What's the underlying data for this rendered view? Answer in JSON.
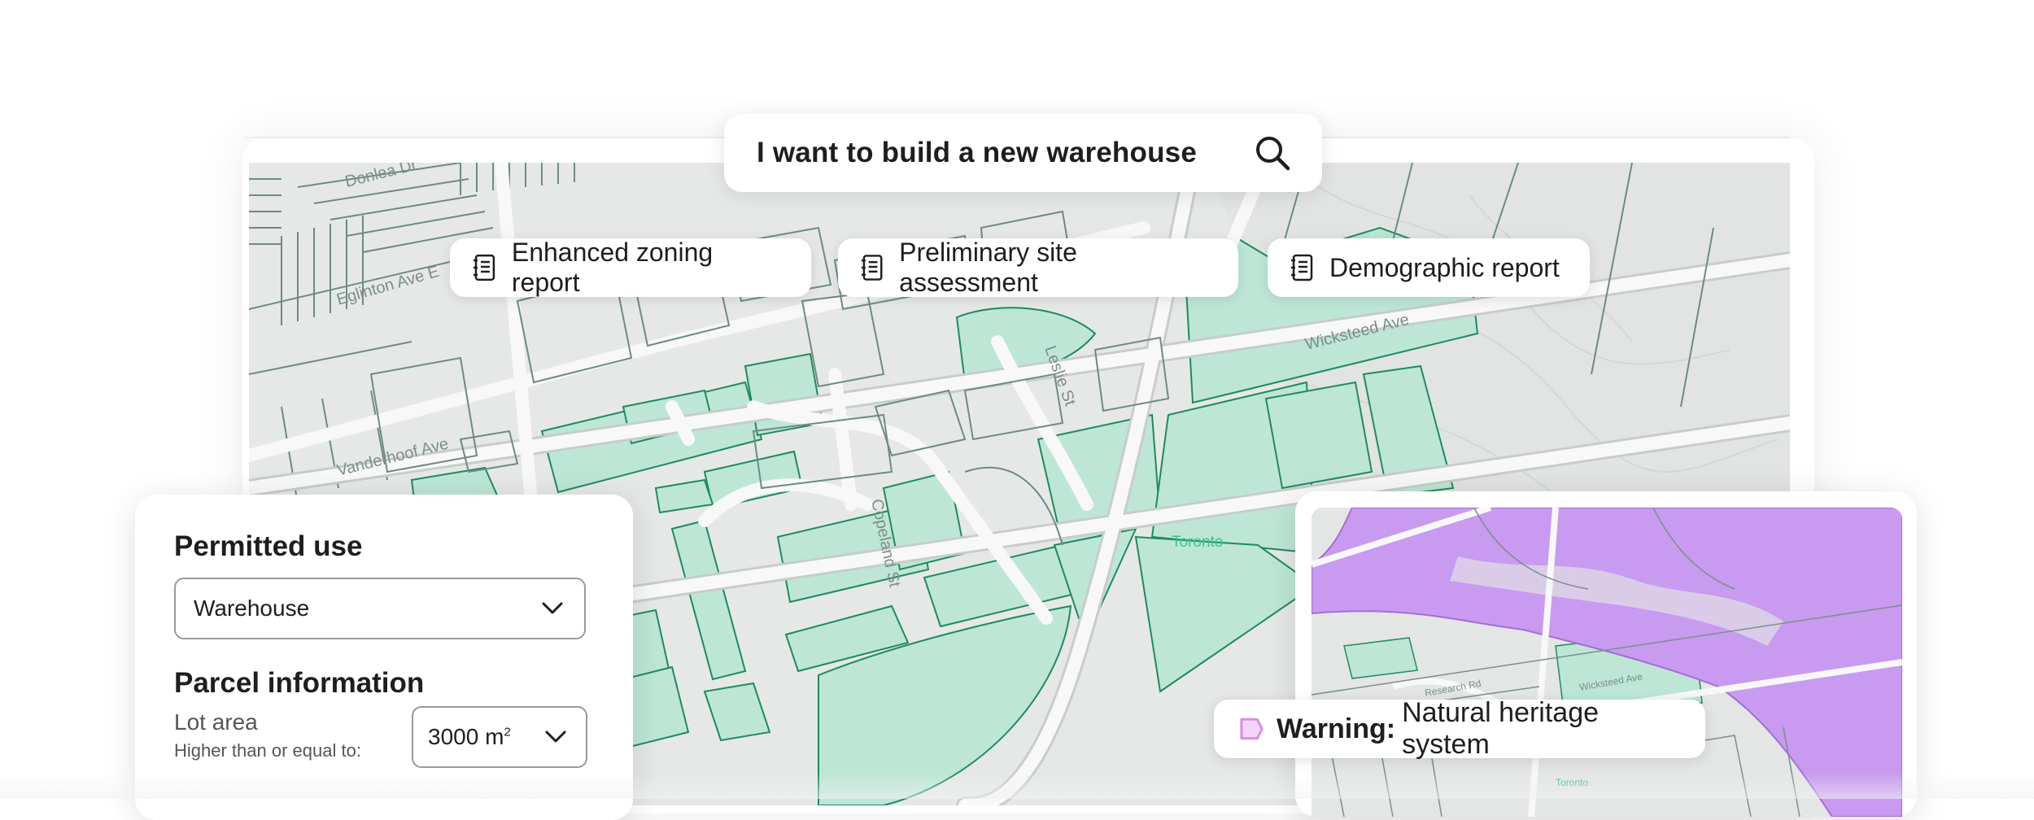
{
  "search": {
    "query": "I want to build a new warehouse",
    "icon": "search-icon"
  },
  "reports": [
    {
      "label": "Enhanced zoning report",
      "icon": "document-icon"
    },
    {
      "label": "Preliminary site assessment",
      "icon": "document-icon"
    },
    {
      "label": "Demographic report",
      "icon": "document-icon"
    }
  ],
  "map": {
    "street_labels": [
      "Donlea Dr",
      "Eglinton Ave E",
      "Vanderhoof Ave",
      "Copeland St",
      "Leslie St",
      "Wicksteed Ave",
      "Toronto"
    ],
    "colors": {
      "background": "#e5e8e7",
      "road": "#f7f8f7",
      "parcel_outline": "#51756c",
      "zoning_fill": "#bde6d6",
      "zoning_outline": "#1e8b5c",
      "heritage_fill": "#c89af0",
      "accent_label": "#3cc48e"
    }
  },
  "left_panel": {
    "permitted_use_heading": "Permitted use",
    "permitted_use_value": "Warehouse",
    "parcel_heading": "Parcel information",
    "lot_area_label": "Lot area",
    "lot_area_sub": "Higher than or equal to:",
    "lot_area_value": "3000 m",
    "lot_area_unit_sup": "2"
  },
  "right_panel": {
    "mini_map_labels": [
      "Research Rd",
      "Wicksteed Ave",
      "Toronto"
    ]
  },
  "warning": {
    "bold": "Warning:",
    "text": "Natural heritage system",
    "icon": "flag-icon",
    "icon_color": "#d98be6"
  }
}
